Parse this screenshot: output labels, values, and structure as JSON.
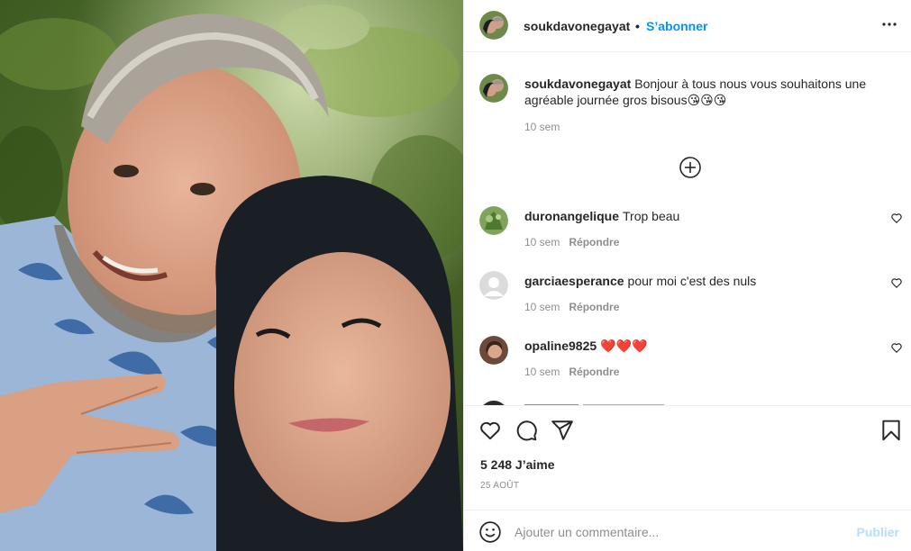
{
  "post": {
    "author": "soukdavonegayat",
    "follow_label": "S’abonner",
    "dot": "•",
    "caption_text": "Bonjour à tous nous vous souhaitons une agréable journée gros bisous😘😘😘",
    "caption_time": "10 sem",
    "likes": "5 248 J’aime",
    "date": "25 AOÛT"
  },
  "comments": [
    {
      "username": "duronangelique",
      "text": "Trop beau",
      "time": "10 sem",
      "reply_label": "Répondre",
      "avatar": "plant-avatar"
    },
    {
      "username": "garciaesperance",
      "text": "pour moi c'est des nuls",
      "time": "10 sem",
      "reply_label": "Répondre",
      "avatar": "default-avatar"
    },
    {
      "username": "opaline9825",
      "text": "❤️❤️❤️",
      "time": "10 sem",
      "reply_label": "Répondre",
      "avatar": "woman-avatar"
    }
  ],
  "add_comment": {
    "placeholder": "Ajouter un commentaire...",
    "publish_label": "Publier"
  },
  "icons": {
    "more": "more-options-icon",
    "load_more": "plus-circle-icon",
    "like": "heart-icon",
    "comment": "comment-icon",
    "share": "paper-plane-icon",
    "save": "bookmark-icon",
    "emoji": "smiley-icon"
  },
  "colors": {
    "accent": "#0095f6",
    "publish_disabled": "#b2dffc",
    "secondary_text": "#8e8e8e",
    "border": "#efefef"
  }
}
